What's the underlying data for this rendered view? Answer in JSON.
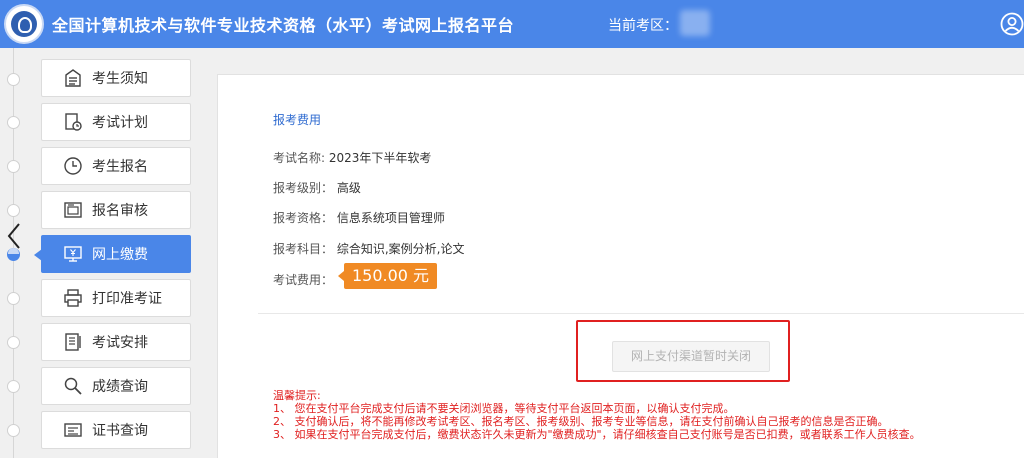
{
  "header": {
    "title": "全国计算机技术与软件专业技术资格（水平）考试网上报名平台",
    "region_label": "当前考区：",
    "region_value": ""
  },
  "sidebar": {
    "items": [
      {
        "label": "考生须知",
        "icon": "notice-icon",
        "active": false
      },
      {
        "label": "考试计划",
        "icon": "plan-icon",
        "active": false
      },
      {
        "label": "考生报名",
        "icon": "clock-icon",
        "active": false
      },
      {
        "label": "报名审核",
        "icon": "review-icon",
        "active": false
      },
      {
        "label": "网上缴费",
        "icon": "payment-icon",
        "active": true
      },
      {
        "label": "打印准考证",
        "icon": "printer-icon",
        "active": false
      },
      {
        "label": "考试安排",
        "icon": "schedule-icon",
        "active": false
      },
      {
        "label": "成绩查询",
        "icon": "search-icon",
        "active": false
      },
      {
        "label": "证书查询",
        "icon": "certificate-icon",
        "active": false
      }
    ]
  },
  "main": {
    "section_title": "报考费用",
    "exam_name_label": "考试名称:",
    "exam_name": "2023年下半年软考",
    "level_label": "报考级别：",
    "level": "高级",
    "qualification_label": "报考资格：",
    "qualification": "信息系统项目管理师",
    "subjects_label": "报考科目：",
    "subjects": "综合知识,案例分析,论文",
    "fee_label": "考试费用：",
    "fee": "150.00 元",
    "pay_button": "网上支付渠道暂时关闭",
    "tips_title": "温馨提示:",
    "tips": [
      "1、  您在支付平台完成支付后请不要关闭浏览器，等待支付平台返回本页面，以确认支付完成。",
      "2、  支付确认后，将不能再修改考试考区、报名考区、报考级别、报考专业等信息，请在支付前确认自己报考的信息是否正确。",
      "3、  如果在支付平台完成支付后，缴费状态许久未更新为\"缴费成功\"，请仔细核查自己支付账号是否已扣费，或者联系工作人员核查。"
    ]
  },
  "colors": {
    "header_bg": "#4a86e8",
    "active_nav": "#4a86e8",
    "fee_badge": "#f08a24",
    "tips_text": "#e02020",
    "highlight_border": "#e02020"
  }
}
